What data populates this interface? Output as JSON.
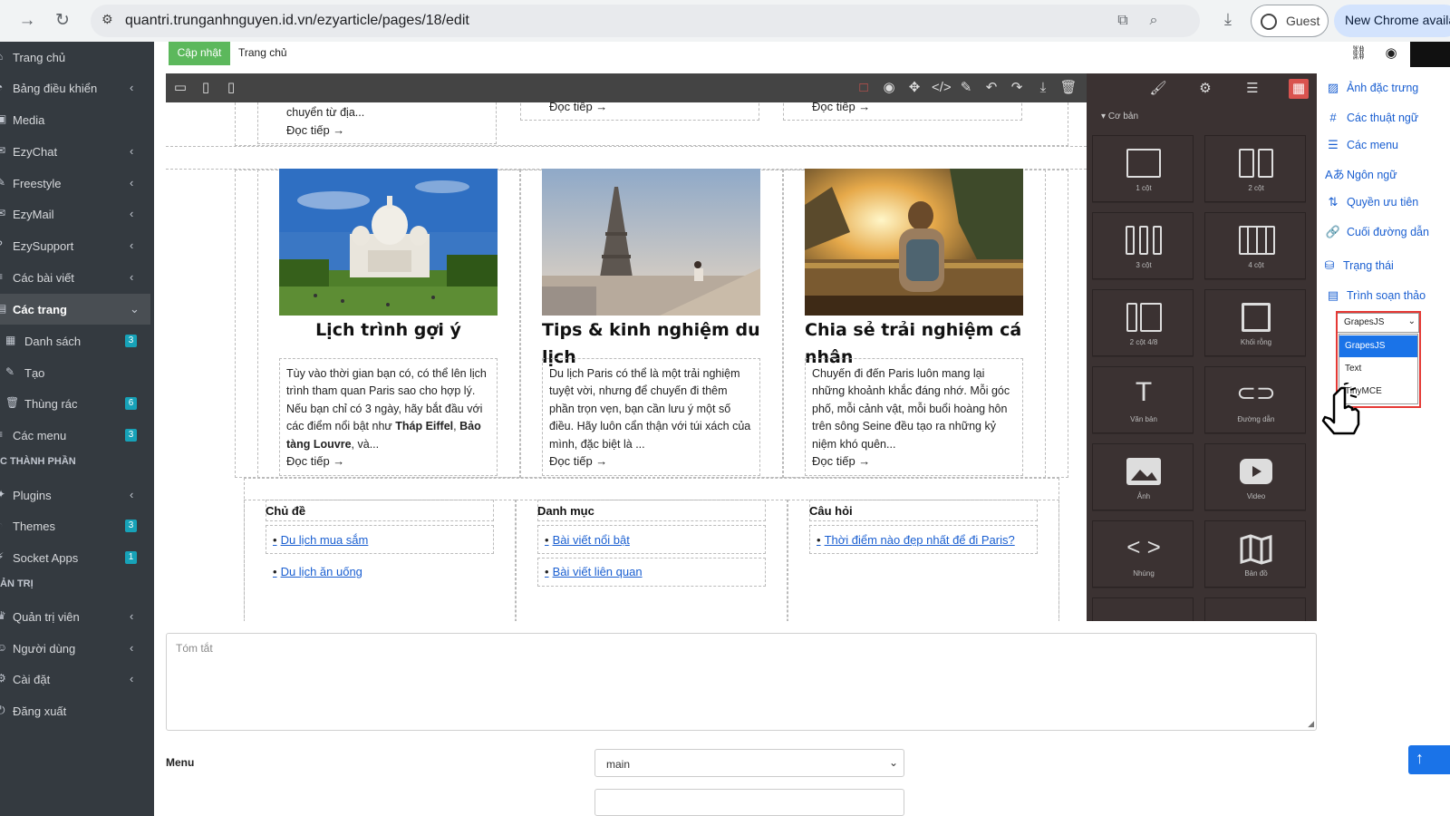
{
  "browser": {
    "url": "quantri.trunganhnguyen.id.vn/ezyarticle/pages/18/edit",
    "guest_label": "Guest",
    "new_chrome_label": "New Chrome availab"
  },
  "sidebar": {
    "items": [
      {
        "label": "Trang chủ",
        "icon": "home-icon"
      },
      {
        "label": "Bảng điều khiển",
        "icon": "dashboard-icon"
      },
      {
        "label": "Media",
        "icon": "media-icon"
      },
      {
        "label": "EzyChat",
        "icon": "chat-icon"
      },
      {
        "label": "Freestyle",
        "icon": "freestyle-icon"
      },
      {
        "label": "EzyMail",
        "icon": "mail-icon"
      },
      {
        "label": "EzySupport",
        "icon": "support-icon"
      },
      {
        "label": "Các bài viết",
        "icon": "article-icon"
      },
      {
        "label": "Các trang",
        "icon": "page-icon"
      },
      {
        "label": "Danh sách",
        "icon": "list-icon",
        "badge": "3"
      },
      {
        "label": "Tạo",
        "icon": "edit-icon"
      },
      {
        "label": "Thùng rác",
        "icon": "trash-icon",
        "badge": "6"
      },
      {
        "label": "Các menu",
        "icon": "menu-icon",
        "badge": "3"
      },
      {
        "label": "Plugins",
        "icon": "plugin-icon"
      },
      {
        "label": "Themes",
        "icon": "theme-icon",
        "badge": "3"
      },
      {
        "label": "Socket Apps",
        "icon": "socket-icon",
        "badge": "1"
      },
      {
        "label": "Quản trị viên",
        "icon": "admin-icon"
      },
      {
        "label": "Người dùng",
        "icon": "users-icon"
      },
      {
        "label": "Cài đặt",
        "icon": "settings-icon"
      },
      {
        "label": "Đăng xuất",
        "icon": "logout-icon"
      }
    ],
    "section_components": "C THÀNH PHẦN",
    "section_admin": "ẢN TRỊ"
  },
  "topbar": {
    "update_label": "Cập nhật",
    "breadcrumb": "Trang chủ"
  },
  "canvas": {
    "top_row": {
      "col1_text": "chuyển từ địa...",
      "read_more": "Đọc tiếp →"
    },
    "cards": [
      {
        "title": "Lịch trình gợi ý",
        "body_html": "Tùy vào thời gian bạn có, có thể lên lịch trình tham quan Paris sao cho hợp lý. Nếu bạn chỉ có 3 ngày, hãy bắt đầu với các điểm nổi bật như <b>Tháp Eiffel</b>, <b>Bảo tàng Louvre</b>, và...",
        "read_more": "Đọc tiếp →"
      },
      {
        "title": "Tips & kinh nghiệm du lịch",
        "body_html": "Du lịch Paris có thể là một trải nghiệm tuyệt vời, nhưng để chuyến đi thêm phần trọn vẹn, bạn cần lưu ý một số điều. Hãy luôn cẩn thận với túi xách của mình, đặc biệt là ...",
        "read_more": "Đọc tiếp →"
      },
      {
        "title": "Chia sẻ trải nghiệm cá nhân",
        "body_html": "Chuyến đi đến Paris luôn mang lại những khoảnh khắc đáng nhớ. Mỗi góc phố, mỗi cảnh vật, mỗi buổi hoàng hôn trên sông Seine đều tạo ra những kỷ niệm khó quên...",
        "read_more": "Đọc tiếp →"
      }
    ],
    "taxonomy": {
      "topics_title": "Chủ đề",
      "topics": [
        "Du lịch mua sắm",
        "Du lịch ăn uống"
      ],
      "categories_title": "Danh mục",
      "categories": [
        "Bài viết nổi bật",
        "Bài viết liên quan"
      ],
      "questions_title": "Câu hỏi",
      "questions": [
        "Thời điểm nào đẹp nhất để đi Paris?"
      ]
    }
  },
  "blocks_panel": {
    "section": "Cơ bản",
    "blocks": [
      "1 cột",
      "2 cột",
      "3 cột",
      "4 cột",
      "2 cột 4/8",
      "Khối rỗng",
      "Văn bản",
      "Đường dẫn",
      "Ảnh",
      "Video",
      "Nhúng",
      "Bản đồ"
    ]
  },
  "right_settings": {
    "items": [
      {
        "label": "Ảnh đặc trưng",
        "icon": "image-icon"
      },
      {
        "label": "Các thuật ngữ",
        "icon": "hash-icon"
      },
      {
        "label": "Các menu",
        "icon": "menu-icon"
      },
      {
        "label": "Ngôn ngữ",
        "icon": "language-icon"
      },
      {
        "label": "Quyền ưu tiên",
        "icon": "priority-icon"
      },
      {
        "label": "Cuối đường dẫn",
        "icon": "link-icon"
      },
      {
        "label": "Trạng thái",
        "icon": "status-icon"
      },
      {
        "label": "Trình soạn thảo",
        "icon": "editor-icon"
      }
    ],
    "editor_select_value": "GrapesJS",
    "editor_options": [
      "GrapesJS",
      "Text",
      "TinyMCE"
    ]
  },
  "summary": {
    "placeholder": "Tóm tắt"
  },
  "menu_field": {
    "label": "Menu",
    "value": "main"
  },
  "colors": {
    "sidebar_bg": "#343a40",
    "editor_panel_bg": "#3b3232",
    "update_btn": "#5cb85c",
    "badge": "#17a2b8",
    "link": "#1a5fd1",
    "highlight": "#e53935"
  }
}
